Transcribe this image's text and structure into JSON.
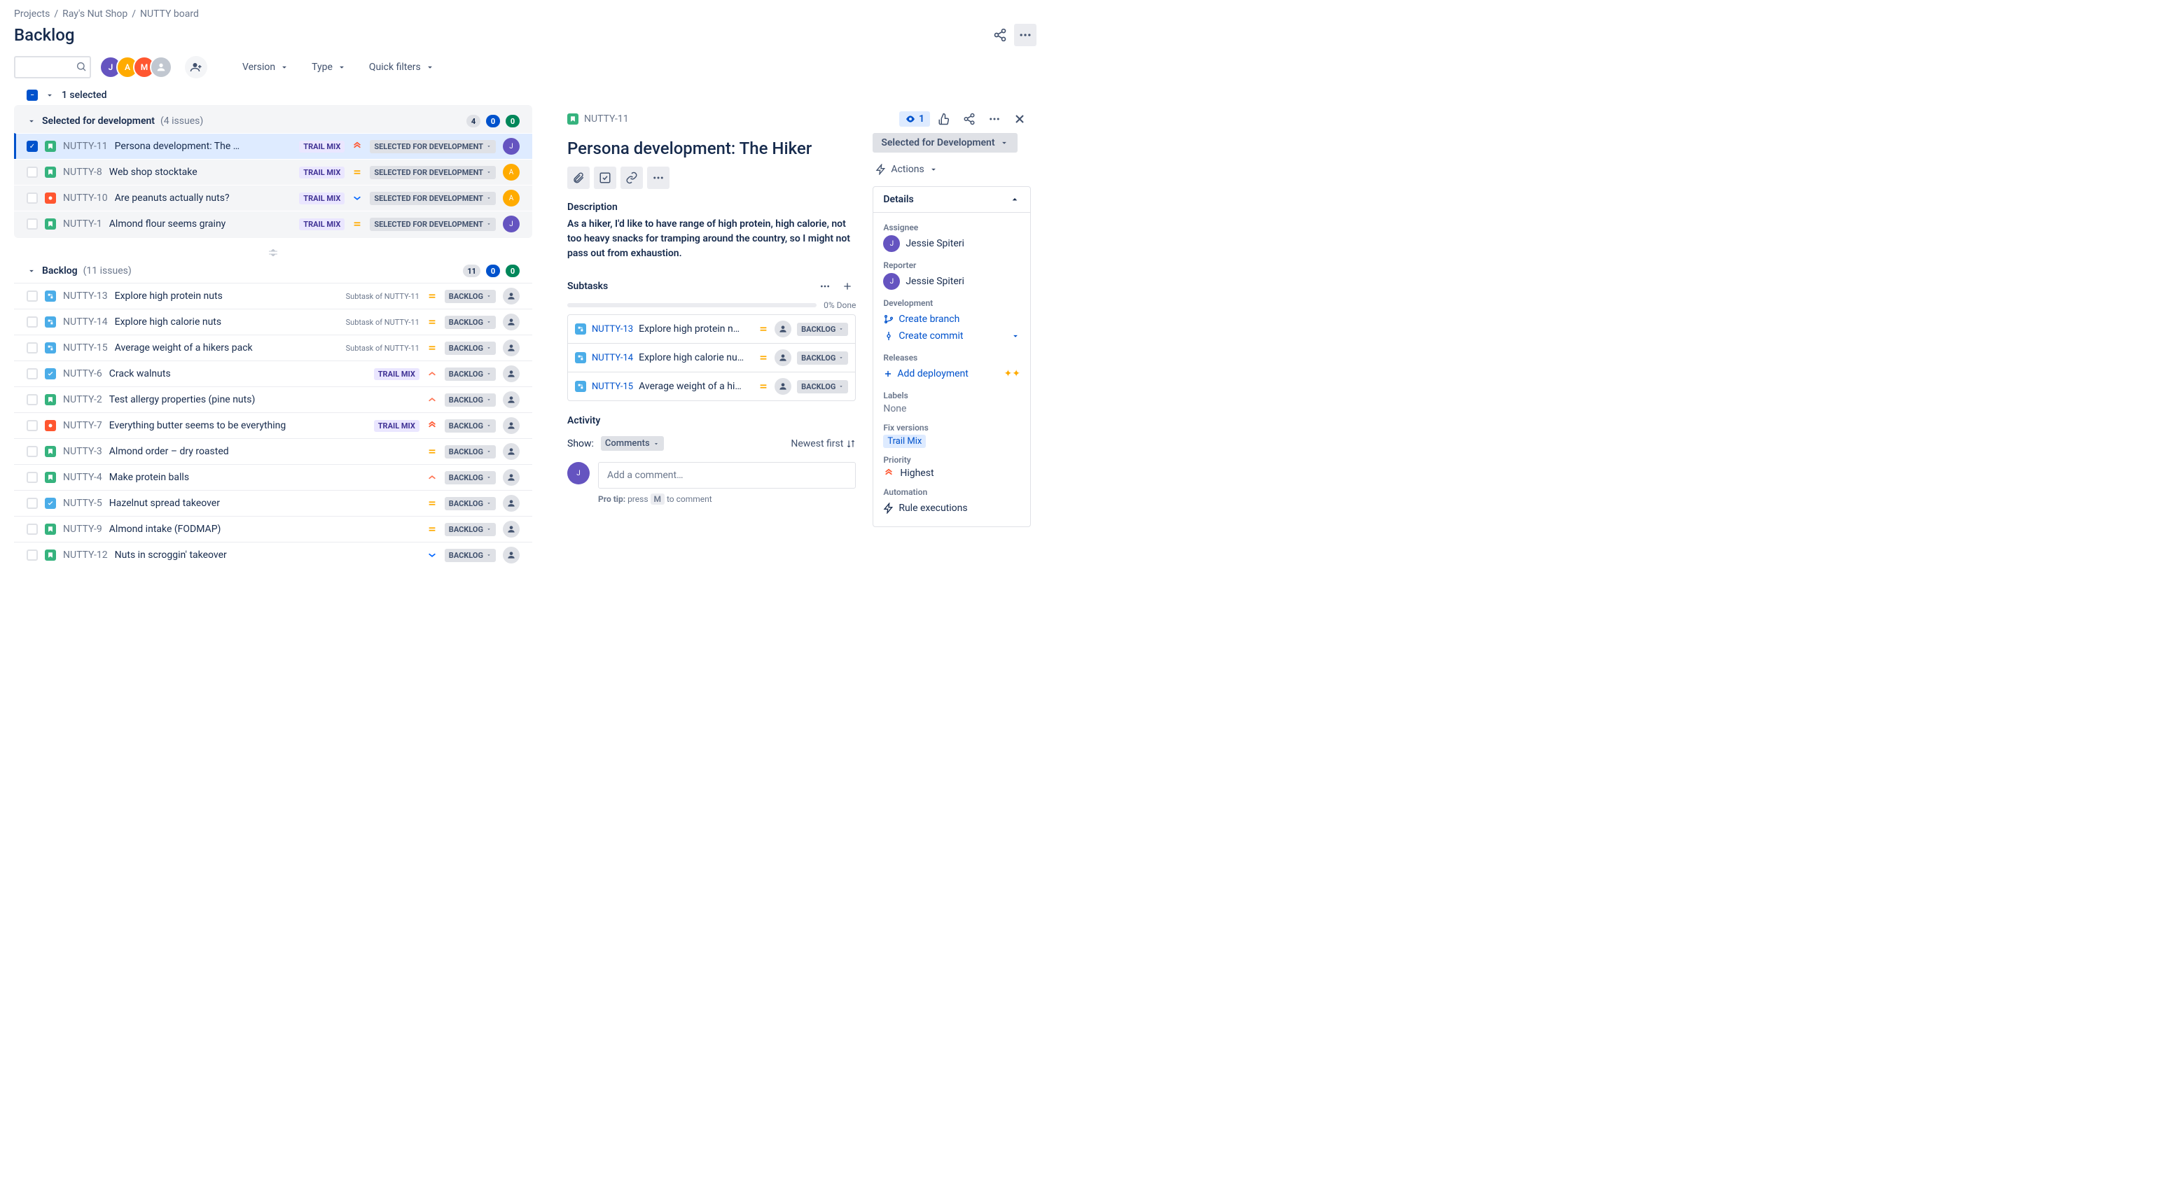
{
  "breadcrumb": [
    "Projects",
    "Ray's Nut Shop",
    "NUTTY board"
  ],
  "page_title": "Backlog",
  "filters": {
    "version": "Version",
    "type": "Type",
    "quick": "Quick filters"
  },
  "selection": {
    "count_label": "1 selected"
  },
  "sections": {
    "sfd": {
      "title": "Selected for development",
      "count": "(4 issues)",
      "est": "4",
      "inprog": "0",
      "done": "0"
    },
    "backlog": {
      "title": "Backlog",
      "count": "(11 issues)",
      "est": "11",
      "inprog": "0",
      "done": "0"
    }
  },
  "statuses": {
    "sfd": "SELECTED FOR DEVELOPMENT",
    "backlog": "BACKLOG"
  },
  "epic": {
    "trailmix": "TRAIL MIX"
  },
  "sfd_issues": [
    {
      "key": "NUTTY-11",
      "summary": "Persona development: The …",
      "type": "story",
      "epic": "trailmix",
      "prio": "highest",
      "status": "sfd",
      "selected": true,
      "av": "j"
    },
    {
      "key": "NUTTY-8",
      "summary": "Web shop stocktake",
      "type": "story",
      "epic": "trailmix",
      "prio": "medium",
      "status": "sfd",
      "av": "a"
    },
    {
      "key": "NUTTY-10",
      "summary": "Are peanuts actually nuts?",
      "type": "bug",
      "epic": "trailmix",
      "prio": "low",
      "status": "sfd",
      "av": "a"
    },
    {
      "key": "NUTTY-1",
      "summary": "Almond flour seems grainy",
      "type": "story",
      "epic": "trailmix",
      "prio": "medium",
      "status": "sfd",
      "av": "j"
    }
  ],
  "backlog_issues": [
    {
      "key": "NUTTY-13",
      "summary": "Explore high protein nuts",
      "type": "sub",
      "subof": "Subtask of NUTTY-11",
      "prio": "medium",
      "status": "backlog"
    },
    {
      "key": "NUTTY-14",
      "summary": "Explore high calorie nuts",
      "type": "sub",
      "subof": "Subtask of NUTTY-11",
      "prio": "medium",
      "status": "backlog"
    },
    {
      "key": "NUTTY-15",
      "summary": "Average weight of a hikers pack",
      "type": "sub",
      "subof": "Subtask of NUTTY-11",
      "prio": "medium",
      "status": "backlog"
    },
    {
      "key": "NUTTY-6",
      "summary": "Crack walnuts",
      "type": "task",
      "epic": "trailmix",
      "prio": "high",
      "status": "backlog"
    },
    {
      "key": "NUTTY-2",
      "summary": "Test allergy properties (pine nuts)",
      "type": "story",
      "prio": "high",
      "status": "backlog"
    },
    {
      "key": "NUTTY-7",
      "summary": "Everything butter seems to be everything",
      "type": "bug",
      "epic": "trailmix",
      "prio": "highest",
      "status": "backlog"
    },
    {
      "key": "NUTTY-3",
      "summary": "Almond order – dry roasted",
      "type": "story",
      "prio": "medium",
      "status": "backlog"
    },
    {
      "key": "NUTTY-4",
      "summary": "Make protein balls",
      "type": "story",
      "prio": "high",
      "status": "backlog"
    },
    {
      "key": "NUTTY-5",
      "summary": "Hazelnut spread takeover",
      "type": "task",
      "prio": "medium",
      "status": "backlog"
    },
    {
      "key": "NUTTY-9",
      "summary": "Almond intake (FODMAP)",
      "type": "story",
      "prio": "medium",
      "status": "backlog"
    },
    {
      "key": "NUTTY-12",
      "summary": "Nuts in scroggin' takeover",
      "type": "story",
      "prio": "low",
      "status": "backlog"
    }
  ],
  "detail": {
    "key": "NUTTY-11",
    "title": "Persona development: The Hiker",
    "watch": "1",
    "status_label": "Selected for Development",
    "actions_label": "Actions",
    "desc_label": "Description",
    "desc": "As a hiker, I'd like to have range of high protein, high calorie, not too heavy snacks for tramping around the country, so I might not pass out from exhaustion.",
    "subtasks_label": "Subtasks",
    "progress": "0% Done",
    "subtasks": [
      {
        "key": "NUTTY-13",
        "summary": "Explore high protein n…",
        "prio": "medium",
        "status": "BACKLOG"
      },
      {
        "key": "NUTTY-14",
        "summary": "Explore high calorie nu…",
        "prio": "medium",
        "status": "BACKLOG"
      },
      {
        "key": "NUTTY-15",
        "summary": "Average weight of a hi…",
        "prio": "medium",
        "status": "BACKLOG"
      }
    ],
    "activity_label": "Activity",
    "show_label": "Show:",
    "comments_tab": "Comments",
    "sort_label": "Newest first",
    "comment_placeholder": "Add a comment…",
    "protip_a": "Pro tip:",
    "protip_b": "press",
    "protip_key": "M",
    "protip_c": "to comment",
    "details_label": "Details",
    "assignee_label": "Assignee",
    "assignee": "Jessie Spiteri",
    "reporter_label": "Reporter",
    "reporter": "Jessie Spiteri",
    "dev_label": "Development",
    "create_branch": "Create branch",
    "create_commit": "Create commit",
    "releases_label": "Releases",
    "add_deployment": "Add deployment",
    "labels_label": "Labels",
    "labels_val": "None",
    "fixv_label": "Fix versions",
    "fixv_val": "Trail Mix",
    "prio_label": "Priority",
    "prio_val": "Highest",
    "auto_label": "Automation",
    "rule_exec": "Rule executions"
  }
}
